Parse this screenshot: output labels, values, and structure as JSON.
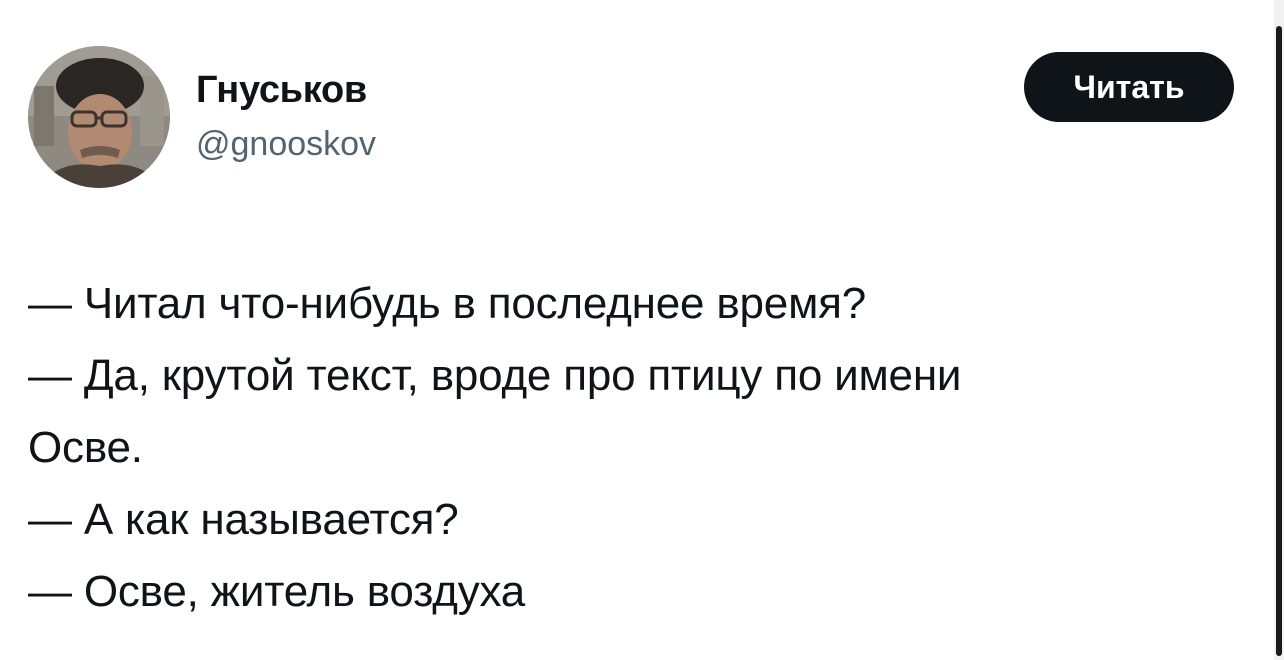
{
  "author": {
    "display_name": "Гнуськов",
    "handle": "@gnooskov",
    "avatar_icon": "avatar-photo"
  },
  "follow_button": {
    "label": "Читать"
  },
  "tweet": {
    "lines": [
      "— Читал что-нибудь в последнее время?",
      "— Да, крутой текст, вроде про птицу по имени",
      "Осве.",
      "— А как называется?",
      "— Осве, житель воздуха"
    ]
  },
  "colors": {
    "text": "#0f1419",
    "secondary": "#536471",
    "button_bg": "#0f1419",
    "button_text": "#ffffff"
  }
}
